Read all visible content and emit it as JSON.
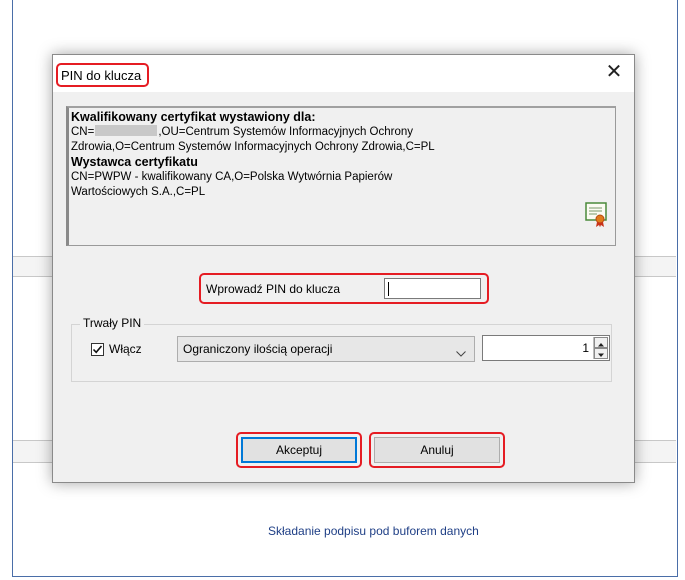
{
  "background": {
    "link_text": "Składanie podpisu pod buforem danych"
  },
  "dialog": {
    "title": "PIN do klucza",
    "close_glyph": "✕",
    "certificate": {
      "subject_heading": "Kwalifikowany certyfikat wystawiony dla:",
      "subject_line1_prefix": "CN=",
      "subject_line1_rest": ",OU=Centrum Systemów Informacyjnych Ochrony",
      "subject_line2": "Zdrowia,O=Centrum Systemów Informacyjnych Ochrony Zdrowia,C=PL",
      "issuer_heading": "Wystawca certyfikatu",
      "issuer_line1": "CN=PWPW - kwalifikowany CA,O=Polska Wytwórnia Papierów",
      "issuer_line2": "Wartościowych S.A.,C=PL",
      "icon": "certificate-icon"
    },
    "pin": {
      "label": "Wprowadź PIN do klucza",
      "value": ""
    },
    "persistent_pin": {
      "legend": "Trwały PIN",
      "checkbox_label": "Włącz",
      "checked": true,
      "mode_selected": "Ograniczony ilością operacji",
      "count_value": "1"
    },
    "buttons": {
      "accept": "Akceptuj",
      "cancel": "Anuluj"
    },
    "highlight_color": "#e51c23"
  }
}
